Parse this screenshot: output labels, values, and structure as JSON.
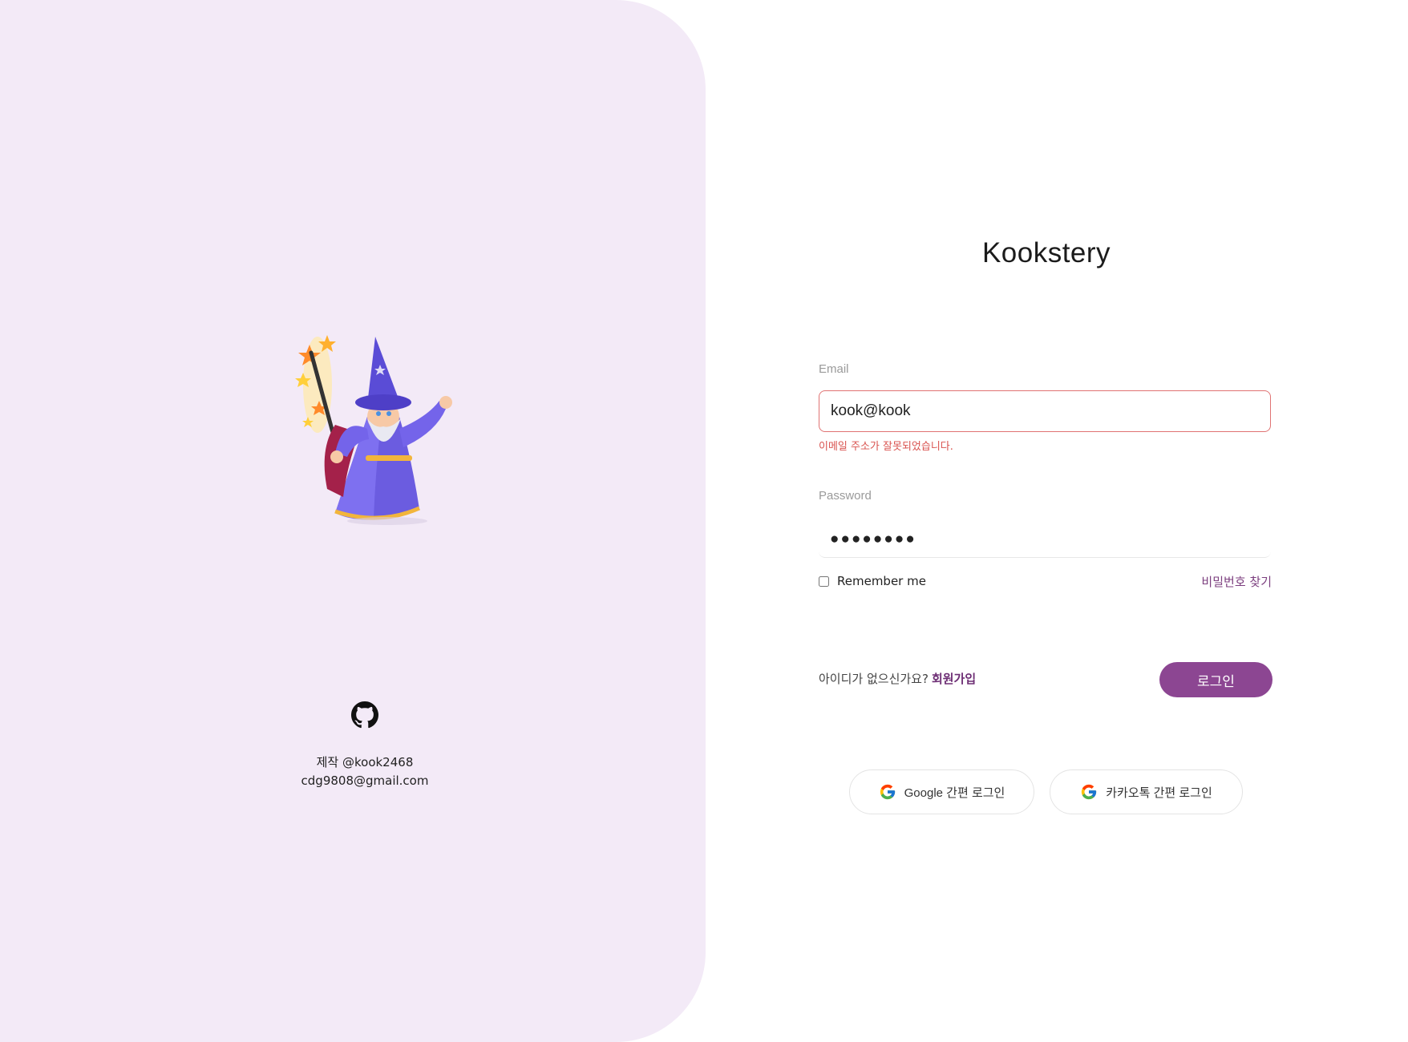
{
  "brand": {
    "title": "Kookstery"
  },
  "left_panel": {
    "credit_line1": "제작 @kook2468",
    "credit_line2": "cdg9808@gmail.com"
  },
  "form": {
    "email_label": "Email",
    "email_value": "kook@kook",
    "email_error": "이메일 주소가 잘못되었습니다.",
    "password_label": "Password",
    "password_value": "●●●●●●●●",
    "remember_label": "Remember me",
    "remember_checked": false,
    "find_password_label": "비밀번호 찾기",
    "signup_prompt": "아이디가 없으신가요?",
    "signup_link": "회원가입",
    "login_button": "로그인"
  },
  "social": {
    "google_label": "Google 간편 로그인",
    "kakao_label": "카카오톡 간편 로그인"
  },
  "colors": {
    "left_panel_bg": "#f3eaf7",
    "accent": "#8c4692",
    "error": "#d9534f",
    "link": "#6e2f75"
  },
  "icons": {
    "github": "github-icon",
    "google": "google-g-icon",
    "wizard": "wizard-illustration"
  }
}
